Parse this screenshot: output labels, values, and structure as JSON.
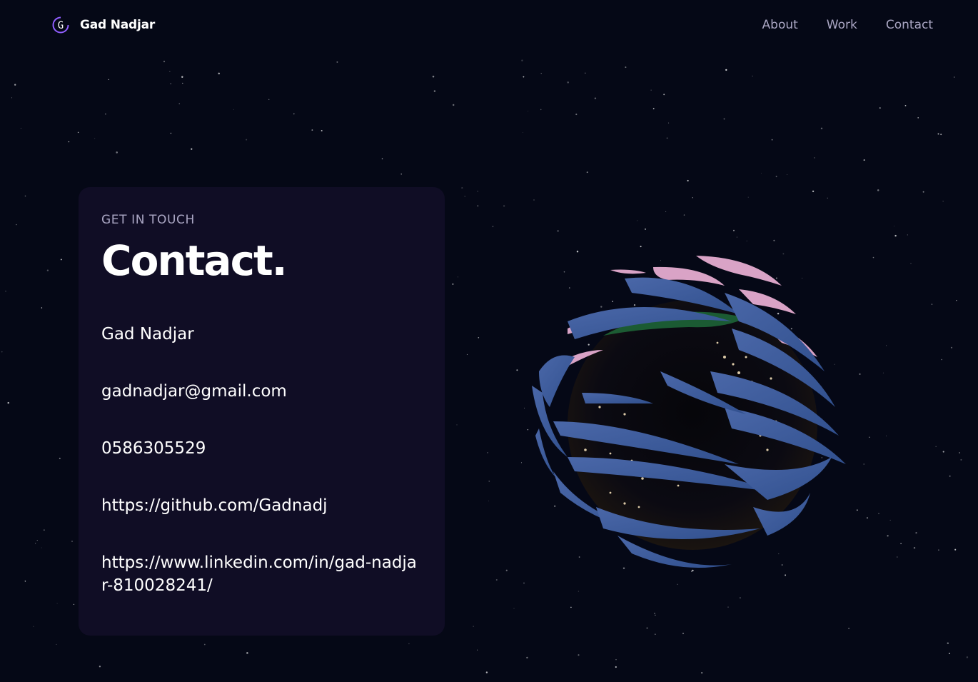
{
  "navbar": {
    "brand_name": "Gad Nadjar",
    "logo_letter": "G",
    "links": [
      {
        "label": "About"
      },
      {
        "label": "Work"
      },
      {
        "label": "Contact"
      }
    ]
  },
  "contact": {
    "subtitle": "Get in touch",
    "title": "Contact.",
    "name": "Gad Nadjar",
    "email": "gadnadjar@gmail.com",
    "phone": "0586305529",
    "github": "https://github.com/Gadnadj",
    "linkedin": "https://www.linkedin.com/in/gad-nadjar-810028241/"
  },
  "colors": {
    "background": "#050816",
    "card": "#100d25",
    "secondary_text": "#aaa6c3",
    "accent_purple": "#915eff",
    "globe_band": "#3d5a9a",
    "globe_pink": "#d7a0c4"
  },
  "icons": {
    "logo": "logo-g-icon",
    "globe": "3d-earth-globe"
  }
}
